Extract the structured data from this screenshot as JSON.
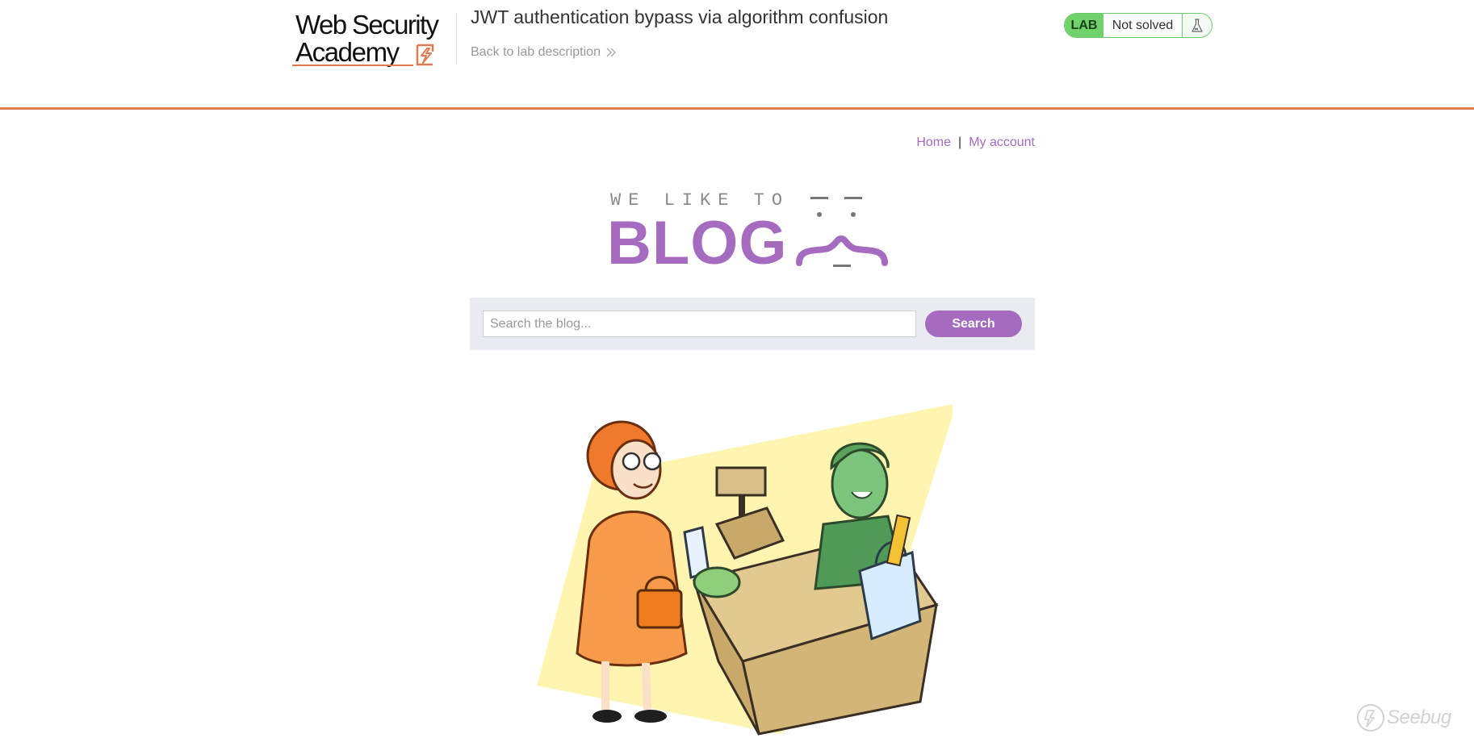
{
  "academy": {
    "logo": {
      "line1": "Web Security",
      "line2": "Academy"
    },
    "lab_title": "JWT authentication bypass via algorithm confusion",
    "back_link": "Back to lab description",
    "status": {
      "badge": "LAB",
      "text": "Not solved"
    },
    "colors": {
      "accent": "#e07b4f",
      "lab_green": "#70d26a"
    }
  },
  "blog": {
    "nav": {
      "home": "Home",
      "separator": "|",
      "account": "My account"
    },
    "banner": {
      "tagline": "WE LIKE TO",
      "word": "BLOG"
    },
    "search": {
      "placeholder": "Search the blog...",
      "value": "",
      "button": "Search"
    },
    "colors": {
      "brand": "#a56bbf",
      "panel": "#e8ebef"
    },
    "post_image_icon": "cartoon-shop-checkout-illustration"
  },
  "watermark": {
    "text": "Seebug"
  }
}
